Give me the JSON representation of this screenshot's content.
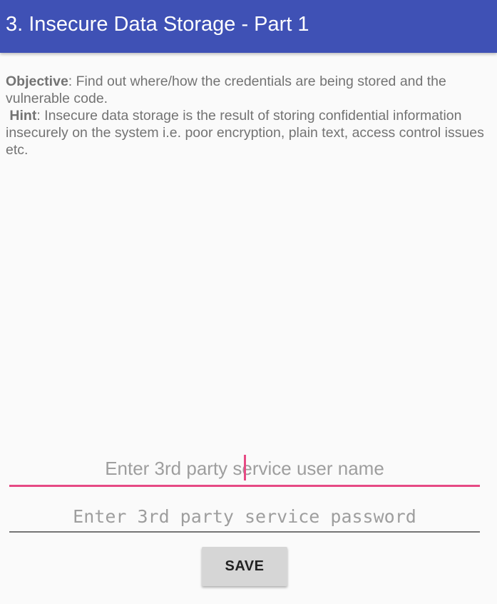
{
  "app_bar": {
    "title": "3. Insecure Data Storage - Part 1"
  },
  "description": {
    "objective_label": "Objective",
    "objective_text": ": Find out where/how the credentials are being stored and the vulnerable code.",
    "hint_label": "Hint",
    "hint_text": ": Insecure data storage is the result of storing confidential information insecurely on the system i.e. poor encryption, plain text, access control issues etc."
  },
  "form": {
    "username_placeholder": "Enter 3rd party service user name",
    "username_value": "",
    "password_placeholder": "Enter 3rd party service password",
    "password_value": "",
    "save_label": "SAVE"
  },
  "colors": {
    "app_bar": "#3f51b5",
    "accent": "#e64a84",
    "background": "#fafafa",
    "button": "#d6d6d6"
  }
}
